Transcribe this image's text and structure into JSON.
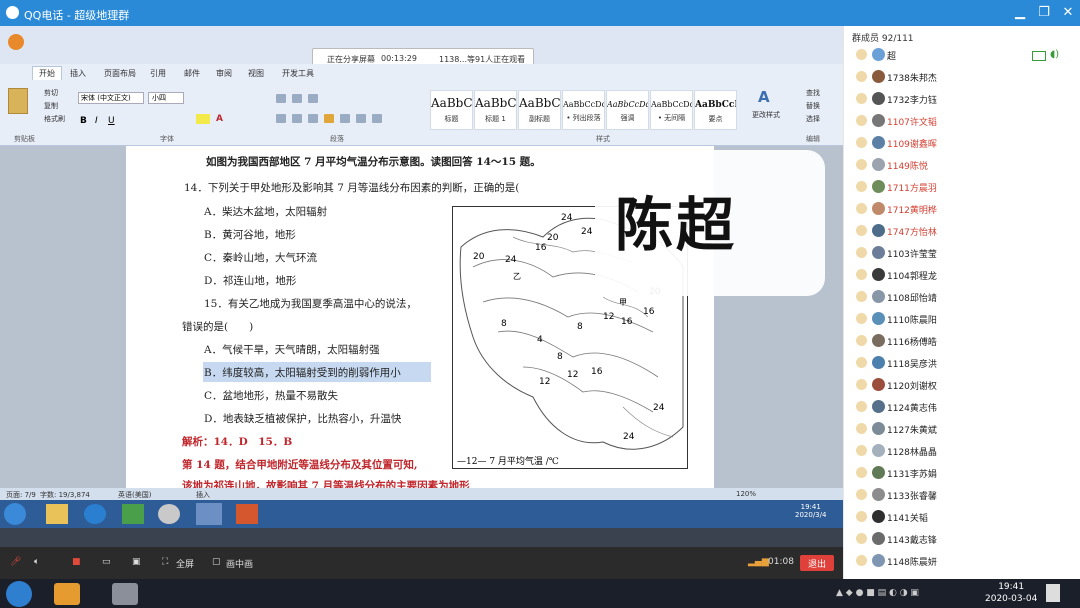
{
  "window": {
    "title": "QQ电话 - 超级地理群"
  },
  "share_bar": {
    "status": "正在分享屏幕",
    "time": "00:13:29",
    "viewers": "1138...等91人正在观看"
  },
  "ribbon": {
    "tabs": [
      "开始",
      "插入",
      "页面布局",
      "引用",
      "邮件",
      "审阅",
      "视图",
      "开发工具"
    ],
    "clipboard": [
      "剪切",
      "复制",
      "格式刷"
    ],
    "font_name": "宋体 (中文正文)",
    "font_size": "小四",
    "styles": [
      {
        "preview": "AaBbC",
        "label": "标题"
      },
      {
        "preview": "AaBbC",
        "label": "标题 1"
      },
      {
        "preview": "AaBbC",
        "label": "副标题"
      },
      {
        "preview": "AaBbCcDd",
        "label": "• 列出段落"
      },
      {
        "preview": "AaBbCcDd",
        "label": "强调"
      },
      {
        "preview": "AaBbCcDd",
        "label": "• 无间隔"
      },
      {
        "preview": "AaBbCcD",
        "label": "要点"
      }
    ],
    "change_styles": "更改样式",
    "edit": [
      "查找",
      "替换",
      "选择"
    ],
    "groups": [
      "剪贴板",
      "字体",
      "段落",
      "样式",
      "编辑"
    ]
  },
  "doc": {
    "intro": "如图为我国西部地区 7 月平均气温分布示意图。读图回答 14～15 题。",
    "q14": "14．下列关于甲处地形及影响其 7 月等温线分布因素的判断，正确的是(",
    "q14_opts": [
      "A．柴达木盆地，太阳辐射",
      "B．黄河谷地，地形",
      "C．秦岭山地，大气环流",
      "D．祁连山地，地形"
    ],
    "q15a": "15．有关乙地成为我国夏季高温中心的说法，",
    "q15b": "错误的是(　　)",
    "q15_opts": [
      "A．气候干旱，天气晴朗，太阳辐射强",
      "B．纬度较高，太阳辐射受到的削弱作用小",
      "C．盆地地形，热量不易散失",
      "D．地表缺乏植被保护，比热容小，升温快"
    ],
    "answer": "解析：14．D　15．B",
    "explain1": "第 14 题，结合甲地附近等温线分布及其位置可知,",
    "explain2": "该地为祁连山地，故影响其 7 月等温线分布的主要因素为地形"
  },
  "map": {
    "legend": "—12— 7 月平均气温 /℃",
    "labels": [
      "24",
      "20",
      "16",
      "24",
      "20",
      "24",
      "16",
      "8",
      "12",
      "16",
      "8",
      "4",
      "8",
      "12",
      "12",
      "16",
      "20",
      "24",
      "24"
    ],
    "places": [
      "甲",
      "乙"
    ]
  },
  "name_overlay": "陈超",
  "status_bar": {
    "page": "页面: 7/9",
    "words": "字数: 19/3,874",
    "lang": "英语(美国)",
    "mode": "插入",
    "zoom": "120%"
  },
  "inner_clock": {
    "time": "19:41",
    "date": "2020/3/4"
  },
  "controls": {
    "fullscreen": "全屏",
    "pip": "画中画",
    "timer": "01:08",
    "exit": "退出"
  },
  "members": {
    "header": "群成员 92/111",
    "list": [
      {
        "name": "超",
        "color": "#222",
        "av": "#6aa0d8"
      },
      {
        "name": "1738朱邦杰",
        "color": "#222",
        "av": "#8a5a3c"
      },
      {
        "name": "1732李力钰",
        "color": "#222",
        "av": "#555"
      },
      {
        "name": "1107许文韬",
        "color": "#d23f31",
        "av": "#777"
      },
      {
        "name": "1109谢鑫晖",
        "color": "#d23f31",
        "av": "#5b7fa5"
      },
      {
        "name": "1149陈悦",
        "color": "#d23f31",
        "av": "#9aa3ae"
      },
      {
        "name": "1711方晨羽",
        "color": "#d23f31",
        "av": "#6f8d5a"
      },
      {
        "name": "1712黄明桦",
        "color": "#d23f31",
        "av": "#c08a6a"
      },
      {
        "name": "1747方怡林",
        "color": "#d23f31",
        "av": "#4d6d8a"
      },
      {
        "name": "1103许莹莹",
        "color": "#222",
        "av": "#6c7d99"
      },
      {
        "name": "1104郭程龙",
        "color": "#222",
        "av": "#3a3a3a"
      },
      {
        "name": "1108邱怡靖",
        "color": "#222",
        "av": "#8897a8"
      },
      {
        "name": "1110陈晨阳",
        "color": "#222",
        "av": "#5a8fb8"
      },
      {
        "name": "1116杨傅皓",
        "color": "#222",
        "av": "#7a6d5f"
      },
      {
        "name": "1118吴彦洪",
        "color": "#222",
        "av": "#4b7fae"
      },
      {
        "name": "1120刘谢权",
        "color": "#222",
        "av": "#9b4e3b"
      },
      {
        "name": "1124黄志伟",
        "color": "#222",
        "av": "#56708c"
      },
      {
        "name": "1127朱黄斌",
        "color": "#222",
        "av": "#7d8a98"
      },
      {
        "name": "1128林晶晶",
        "color": "#222",
        "av": "#a5b0bd"
      },
      {
        "name": "1131李苏娟",
        "color": "#222",
        "av": "#5f7a55"
      },
      {
        "name": "1133张睿馨",
        "color": "#222",
        "av": "#8c8c8c"
      },
      {
        "name": "1141关韬",
        "color": "#222",
        "av": "#2f2f2f"
      },
      {
        "name": "1143戴志锋",
        "color": "#222",
        "av": "#6b6b6b"
      },
      {
        "name": "1148陈晨妍",
        "color": "#222",
        "av": "#7f96b2"
      }
    ]
  },
  "taskbar": {
    "time": "19:41",
    "date": "2020-03-04"
  }
}
